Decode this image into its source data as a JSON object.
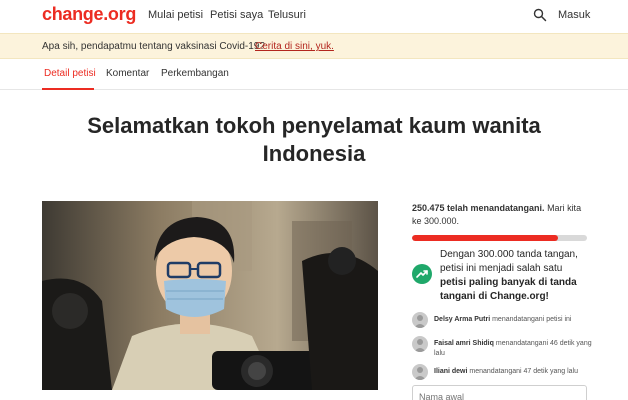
{
  "header": {
    "logo": "change.org",
    "nav": [
      "Mulai petisi",
      "Petisi saya",
      "Telusuri"
    ],
    "login": "Masuk"
  },
  "banner": {
    "text": "Apa sih, pendapatmu tentang vaksinasi Covid-19?",
    "link": " Cerita di sini, yuk."
  },
  "tabs": [
    "Detail petisi",
    "Komentar",
    "Perkembangan"
  ],
  "petition": {
    "title": "Selamatkan tokoh penyelamat kaum wanita Indonesia"
  },
  "signatures": {
    "count": "250.475 telah menandatangani.",
    "goal": " Mari kita ke 300.000.",
    "progress_percent": 83.5
  },
  "milestone": {
    "text_1": "Dengan 300.000 tanda tangan,",
    "text_2": " petisi ini menjadi salah satu ",
    "text_bold": "petisi paling banyak di tanda tangani di Change.org!"
  },
  "recent": [
    {
      "name": "Delsy Arma Putri",
      "action": " menandatangani petisi ini"
    },
    {
      "name": "Faisal amri Shidiq",
      "action": " menandatangani 46 detik yang lalu"
    },
    {
      "name": "Iliani dewi",
      "action": " menandatangani 47 detik yang lalu"
    }
  ],
  "form": {
    "first_name_placeholder": "Nama awal"
  },
  "colors": {
    "brand": "#ec2c22",
    "banner_bg": "#fcf3dc",
    "success": "#1fa86a"
  }
}
